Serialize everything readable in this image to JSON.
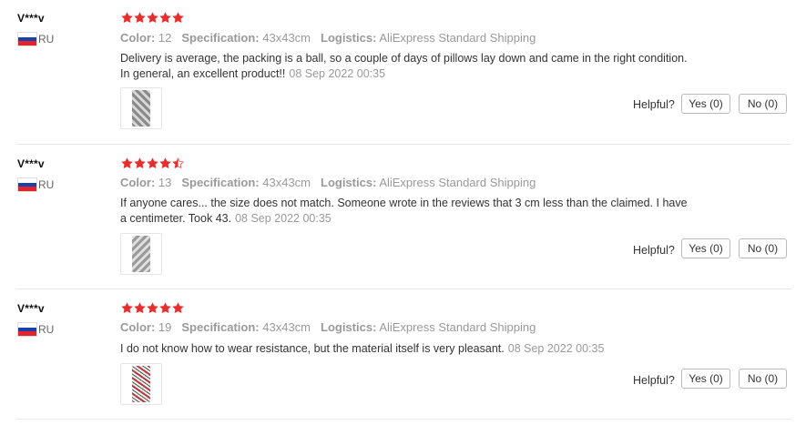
{
  "colors": {
    "star": "#e62e2e",
    "meta": "#999999",
    "flag_blue": "#1c3fa8",
    "flag_red": "#e0262b"
  },
  "icons": {
    "star": "star-icon",
    "flag": "russia-flag-icon"
  },
  "reviews": [
    {
      "user": "V***v",
      "country": "RU",
      "rating": 5,
      "color_label": "Color:",
      "color_value": "12",
      "spec_label": "Specification:",
      "spec_value": "43x43cm",
      "logistics_label": "Logistics:",
      "logistics_value": "AliExpress Standard Shipping",
      "text": "Delivery is average, the packing is a ball, so a couple of days of pillows lay down and came in the right condition. In general, an excellent product!!",
      "date": "08 Sep 2022 00:35",
      "helpful_label": "Helpful?",
      "yes_label": "Yes (0)",
      "no_label": "No (0)"
    },
    {
      "user": "V***v",
      "country": "RU",
      "rating": 4.5,
      "color_label": "Color:",
      "color_value": "13",
      "spec_label": "Specification:",
      "spec_value": "43x43cm",
      "logistics_label": "Logistics:",
      "logistics_value": "AliExpress Standard Shipping",
      "text": "If anyone cares... the size does not match. Someone wrote in the reviews that 3 cm less than the claimed. I have a centimeter. Took 43.",
      "date": "08 Sep 2022 00:35",
      "helpful_label": "Helpful?",
      "yes_label": "Yes (0)",
      "no_label": "No (0)"
    },
    {
      "user": "V***v",
      "country": "RU",
      "rating": 5,
      "color_label": "Color:",
      "color_value": "19",
      "spec_label": "Specification:",
      "spec_value": "43x43cm",
      "logistics_label": "Logistics:",
      "logistics_value": "AliExpress Standard Shipping",
      "text": "I do not know how to wear resistance, but the material itself is very pleasant.",
      "date": "08 Sep 2022 00:35",
      "helpful_label": "Helpful?",
      "yes_label": "Yes (0)",
      "no_label": "No (0)"
    }
  ]
}
